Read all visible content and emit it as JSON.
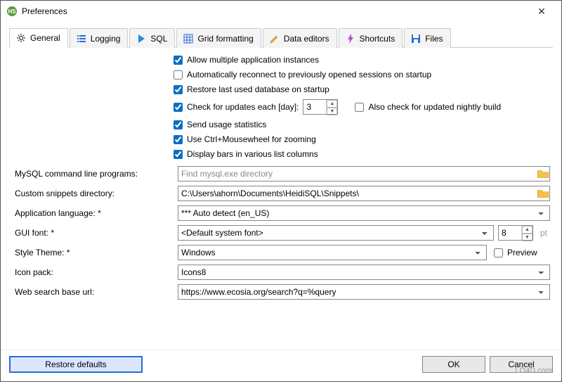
{
  "window": {
    "title": "Preferences"
  },
  "tabs": {
    "general": "General",
    "logging": "Logging",
    "sql": "SQL",
    "grid": "Grid formatting",
    "dataeditors": "Data editors",
    "shortcuts": "Shortcuts",
    "files": "Files"
  },
  "checks": {
    "multi_instances": "Allow multiple application instances",
    "auto_reconnect": "Automatically reconnect to previously opened sessions on startup",
    "restore_db": "Restore last used database on startup",
    "check_updates": "Check for updates each [day]:",
    "update_days": "3",
    "nightly": "Also check for updated nightly build",
    "send_stats": "Send usage statistics",
    "ctrl_wheel": "Use Ctrl+Mousewheel for zooming",
    "display_bars": "Display bars in various list columns"
  },
  "fields": {
    "mysql_label": "MySQL command line programs:",
    "mysql_placeholder": "Find mysql.exe directory",
    "snippets_label": "Custom snippets directory:",
    "snippets_value": "C:\\Users\\ahorn\\Documents\\HeidiSQL\\Snippets\\",
    "language_label": "Application language: *",
    "language_value": "*** Auto detect (en_US)",
    "guifont_label": "GUI font: *",
    "guifont_value": "<Default system font>",
    "guifont_size": "8",
    "pt": "pt",
    "theme_label": "Style Theme: *",
    "theme_value": "Windows",
    "preview": "Preview",
    "iconpack_label": "Icon pack:",
    "iconpack_value": "Icons8",
    "websearch_label": "Web search base url:",
    "websearch_value": "https://www.ecosia.org/search?q=%query"
  },
  "footer": {
    "restore": "Restore defaults",
    "ok": "OK",
    "cancel": "Cancel"
  },
  "watermark": "LO4D.com"
}
